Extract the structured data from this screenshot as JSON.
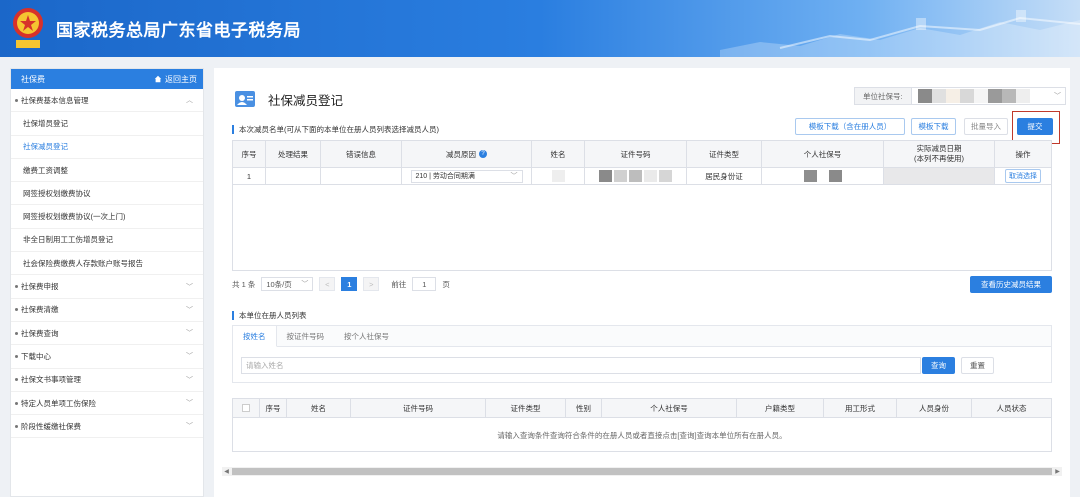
{
  "header": {
    "title": "国家税务总局广东省电子税务局",
    "emblem_text": "中国税务"
  },
  "sidebar": {
    "section": "社保费",
    "home_link": "返回主页",
    "items": [
      {
        "label": "社保费基本信息管理",
        "type": "group",
        "expanded": true
      },
      {
        "label": "社保增员登记",
        "type": "sub"
      },
      {
        "label": "社保减员登记",
        "type": "sub",
        "active": true
      },
      {
        "label": "缴费工资调整",
        "type": "sub"
      },
      {
        "label": "网签授权划缴费协议",
        "type": "sub"
      },
      {
        "label": "网签授权划缴费协议(一次上门)",
        "type": "sub"
      },
      {
        "label": "非全日制用工工伤增员登记",
        "type": "sub"
      },
      {
        "label": "社会保险费缴费人存款账户账号报告",
        "type": "sub"
      },
      {
        "label": "社保费申报",
        "type": "group"
      },
      {
        "label": "社保费清缴",
        "type": "group"
      },
      {
        "label": "社保费查询",
        "type": "group"
      },
      {
        "label": "下载中心",
        "type": "group"
      },
      {
        "label": "社保文书事项管理",
        "type": "group"
      },
      {
        "label": "特定人员单项工伤保险",
        "type": "group"
      },
      {
        "label": "阶段性缓缴社保费",
        "type": "group"
      }
    ]
  },
  "main": {
    "title": "社保减员登记",
    "unit_label": "单位社保号:",
    "toolbar": {
      "download_with_members": "模板下载（含在册人员）",
      "download_template": "模板下载",
      "batch_import": "批量导入",
      "submit": "提交"
    },
    "section1_title": "本次减员名单(可从下面的本单位在册人员列表选择减员人员)",
    "grid1": {
      "headers": [
        "序号",
        "处理结果",
        "错误信息",
        "减员原因",
        "姓名",
        "证件号码",
        "证件类型",
        "个人社保号",
        "实际减员日期\n(本列不再使用)",
        "操作"
      ],
      "rows": [
        {
          "seq": "1",
          "result": "",
          "error": "",
          "reason": "210 | 劳动合同期满",
          "name": "",
          "id_number": "",
          "id_type": "居民身份证",
          "social_no": "",
          "actual_date": "",
          "action": "取消选择"
        }
      ]
    },
    "pager": {
      "total": "共 1 条",
      "page_size": "10条/页",
      "current_page": "1",
      "goto_label": "前往",
      "goto_value": "1",
      "page_unit": "页"
    },
    "history_button": "查看历史减员结果",
    "section2_title": "本单位在册人员列表",
    "search_tabs": [
      "按姓名",
      "按证件号码",
      "按个人社保号"
    ],
    "search_placeholder": "请输入姓名",
    "query_button": "查询",
    "reset_button": "重置",
    "grid2": {
      "headers": [
        "序号",
        "姓名",
        "证件号码",
        "证件类型",
        "性别",
        "个人社保号",
        "户籍类型",
        "用工形式",
        "人员身份",
        "人员状态"
      ],
      "empty_text": "请输入查询条件查询符合条件的在册人员或者直接点击[查询]查询本单位所有在册人员。"
    }
  },
  "colors": {
    "primary": "#2b7fe0",
    "submit_highlight": "#c0392b"
  }
}
